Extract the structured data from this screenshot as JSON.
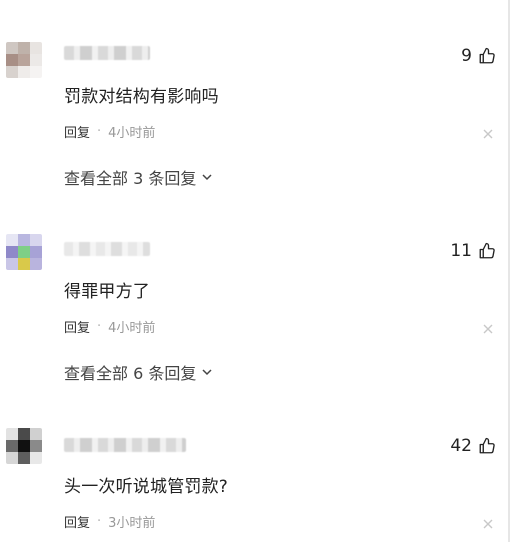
{
  "comments": [
    {
      "likes": "9",
      "text": "罚款对结构有影响吗",
      "reply_label": "回复",
      "separator": "·",
      "time": "4小时前",
      "view_all": "查看全部 3 条回复",
      "avatar_colors": [
        "#cfc7c2",
        "#bfb2aa",
        "#e8e4e1",
        "#a88f86",
        "#b9a49b",
        "#ece9e7",
        "#d8d2ce",
        "#efecea",
        "#f5f3f2"
      ]
    },
    {
      "likes": "11",
      "text": "得罪甲方了",
      "reply_label": "回复",
      "separator": "·",
      "time": "4小时前",
      "view_all": "查看全部 6 条回复",
      "avatar_colors": [
        "#e6e6f4",
        "#b9b7e0",
        "#d8d6ee",
        "#8f89c9",
        "#7fcf86",
        "#a7a2d6",
        "#c9c6e7",
        "#d9c94a",
        "#b9b4de"
      ]
    },
    {
      "likes": "42",
      "text": "头一次听说城管罚款?",
      "reply_label": "回复",
      "separator": "·",
      "time": "3小时前",
      "avatar_colors": [
        "#e2e2e2",
        "#4a4a4a",
        "#d0d0d0",
        "#6a6a6a",
        "#111111",
        "#8a8a8a",
        "#d6d6d6",
        "#5e5e5e",
        "#e8e8e8"
      ]
    }
  ],
  "icons": {
    "like": "thumbs-up-icon",
    "close": "close-icon",
    "expand": "chevron-down-icon"
  }
}
